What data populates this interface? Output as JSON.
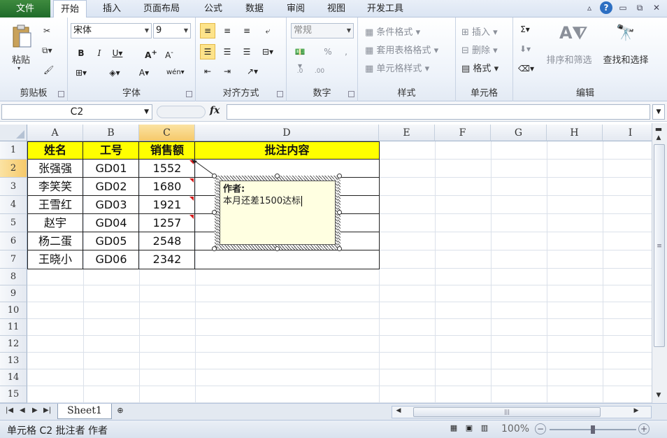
{
  "ribbon": {
    "file_tab": "文件",
    "tabs": [
      "开始",
      "插入",
      "页面布局",
      "公式",
      "数据",
      "审阅",
      "视图",
      "开发工具"
    ],
    "active_tab_index": 0
  },
  "clipboard": {
    "paste": "粘贴",
    "group": "剪贴板"
  },
  "font": {
    "name": "宋体",
    "size": "9",
    "group": "字体"
  },
  "alignment": {
    "group": "对齐方式"
  },
  "number": {
    "format": "常规",
    "group": "数字"
  },
  "styles": {
    "conditional": "条件格式",
    "table": "套用表格格式",
    "cell": "单元格样式",
    "group": "样式"
  },
  "cells": {
    "insert": "插入",
    "delete": "删除",
    "format": "格式",
    "group": "单元格"
  },
  "editing": {
    "sort": "排序和筛选",
    "find": "查找和选择",
    "group": "编辑"
  },
  "formula_bar": {
    "name_box": "C2",
    "value": ""
  },
  "grid": {
    "columns": [
      "A",
      "B",
      "C",
      "D",
      "E",
      "F",
      "G",
      "H",
      "I"
    ],
    "rows": [
      "1",
      "2",
      "3",
      "4",
      "5",
      "6",
      "7",
      "8",
      "9",
      "10",
      "11",
      "12",
      "13",
      "14",
      "15"
    ],
    "selected_cell": "C2"
  },
  "table": {
    "headers": [
      "姓名",
      "工号",
      "销售额",
      "批注内容"
    ],
    "rows": [
      [
        "张强强",
        "GD01",
        "1552"
      ],
      [
        "李笑笑",
        "GD02",
        "1680"
      ],
      [
        "王雪红",
        "GD03",
        "1921"
      ],
      [
        "赵宇",
        "GD04",
        "1257"
      ],
      [
        "杨二蛋",
        "GD05",
        "2548"
      ],
      [
        "王晓小",
        "GD06",
        "2342"
      ]
    ]
  },
  "comment": {
    "author": "作者:",
    "text": "本月还差1500达标"
  },
  "sheets": [
    "Sheet1"
  ],
  "status": {
    "text": "单元格 C2 批注者 作者",
    "zoom": "100%"
  },
  "colors": {
    "header_fill": "#ffff00",
    "comment_fill": "#ffffe1",
    "file_tab": "#2a7a33",
    "comment_marker": "#d81b1b"
  }
}
